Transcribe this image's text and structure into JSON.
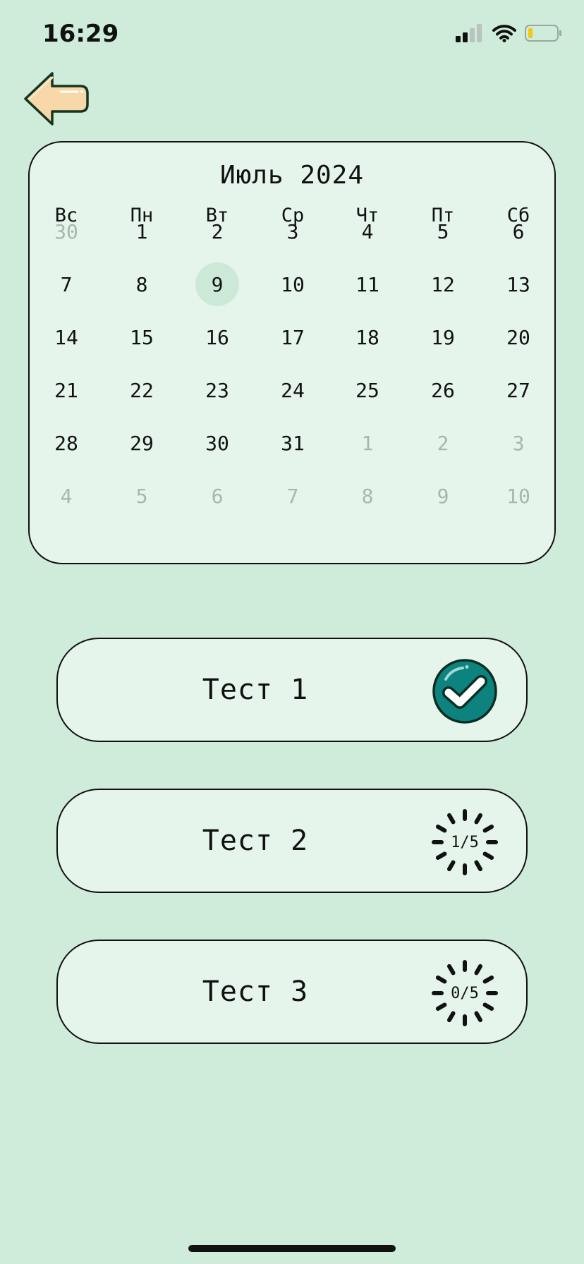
{
  "status_bar": {
    "time": "16:29"
  },
  "calendar": {
    "title": "Июль 2024",
    "weekdays": [
      "Вс",
      "Пн",
      "Вт",
      "Ср",
      "Чт",
      "Пт",
      "Сб"
    ],
    "weeks": [
      [
        {
          "d": "30",
          "m": true
        },
        {
          "d": "1"
        },
        {
          "d": "2"
        },
        {
          "d": "3"
        },
        {
          "d": "4"
        },
        {
          "d": "5"
        },
        {
          "d": "6"
        }
      ],
      [
        {
          "d": "7"
        },
        {
          "d": "8"
        },
        {
          "d": "9",
          "sel": true
        },
        {
          "d": "10"
        },
        {
          "d": "11"
        },
        {
          "d": "12"
        },
        {
          "d": "13"
        }
      ],
      [
        {
          "d": "14"
        },
        {
          "d": "15"
        },
        {
          "d": "16"
        },
        {
          "d": "17"
        },
        {
          "d": "18"
        },
        {
          "d": "19"
        },
        {
          "d": "20"
        }
      ],
      [
        {
          "d": "21"
        },
        {
          "d": "22"
        },
        {
          "d": "23"
        },
        {
          "d": "24"
        },
        {
          "d": "25"
        },
        {
          "d": "26"
        },
        {
          "d": "27"
        }
      ],
      [
        {
          "d": "28"
        },
        {
          "d": "29"
        },
        {
          "d": "30"
        },
        {
          "d": "31"
        },
        {
          "d": "1",
          "m": true
        },
        {
          "d": "2",
          "m": true
        },
        {
          "d": "3",
          "m": true
        }
      ],
      [
        {
          "d": "4",
          "m": true
        },
        {
          "d": "5",
          "m": true
        },
        {
          "d": "6",
          "m": true
        },
        {
          "d": "7",
          "m": true
        },
        {
          "d": "8",
          "m": true
        },
        {
          "d": "9",
          "m": true
        },
        {
          "d": "10",
          "m": true
        }
      ]
    ]
  },
  "tests": [
    {
      "label": "Тест 1",
      "status": "completed",
      "status_icon": "check-icon"
    },
    {
      "label": "Тест 2",
      "status": "in-progress",
      "progress": "1/5",
      "status_icon": "spinner-icon"
    },
    {
      "label": "Тест 3",
      "status": "in-progress",
      "progress": "0/5",
      "status_icon": "spinner-icon"
    }
  ],
  "colors": {
    "background": "#cfecdb",
    "card": "#e6f5ec",
    "selected_day": "#cce9d8",
    "back_arrow": "#f8d7a8",
    "check_badge": "#0d8380",
    "battery_low": "#f2c811"
  }
}
